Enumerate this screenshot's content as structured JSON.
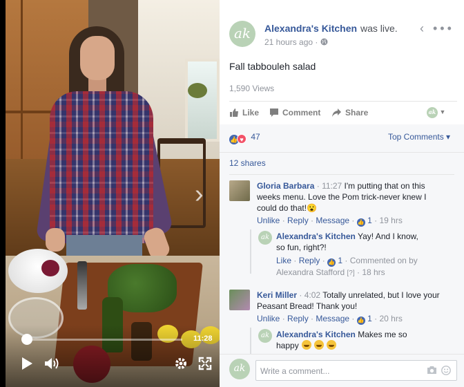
{
  "video": {
    "timecode": "11:28",
    "progress": 0.02,
    "next_glyph": "›",
    "icons": [
      "play-icon",
      "volume-icon",
      "settings-gear-icon",
      "fullscreen-icon",
      "next-video-chevron-icon"
    ]
  },
  "post": {
    "avatar_initials": "ak",
    "page_name": "Alexandra's Kitchen",
    "status_text": "was live.",
    "time_ago": "21 hours ago",
    "privacy_icon": "globe-icon",
    "menu_glyph": "‹ •••",
    "title": "Fall tabbouleh salad",
    "views": "1,590 Views"
  },
  "actions": {
    "like_label": "Like",
    "comment_label": "Comment",
    "share_label": "Share"
  },
  "reactions": {
    "count": "47",
    "types": [
      "like",
      "love"
    ],
    "sort_label": "Top Comments ▾",
    "shares": "12 shares"
  },
  "comments": [
    {
      "author": "Gloria Barbara",
      "time": "11:27",
      "text_l1": "I'm putting that on this",
      "text_l2": "weeks menu. Love the Pom trick-never knew I",
      "text_l3": "could do that!😮",
      "links": {
        "unlike": "Unlike",
        "reply": "Reply",
        "message": "Message",
        "likes": "1",
        "age": "19 hrs"
      },
      "reply": {
        "author": "Alexandra's Kitchen",
        "text_l1": "Yay! And I know,",
        "text_l2": "so fun, right?!",
        "links": {
          "like": "Like",
          "reply": "Reply",
          "likes": "1",
          "note": "Commented on by",
          "by": "Alexandra Stafford",
          "by_mark": "[?]",
          "age": "18 hrs"
        }
      }
    },
    {
      "author": "Keri Miller",
      "time": "4:02",
      "text_l1": "Totally unrelated, but I love your",
      "text_l2": "Peasant Bread! Thank you!",
      "links": {
        "unlike": "Unlike",
        "reply": "Reply",
        "message": "Message",
        "likes": "1",
        "age": "20 hrs"
      },
      "reply": {
        "author": "Alexandra's Kitchen",
        "text_l1": "Makes me so",
        "text_l2": "happy"
      }
    }
  ],
  "composer": {
    "placeholder": "Write a comment...",
    "icons": [
      "camera-icon",
      "emoji-icon"
    ]
  },
  "colors": {
    "link": "#365899",
    "muted": "#90949c",
    "panel_bg": "#f6f7f9",
    "brand_avatar": "#b9d2b6"
  }
}
